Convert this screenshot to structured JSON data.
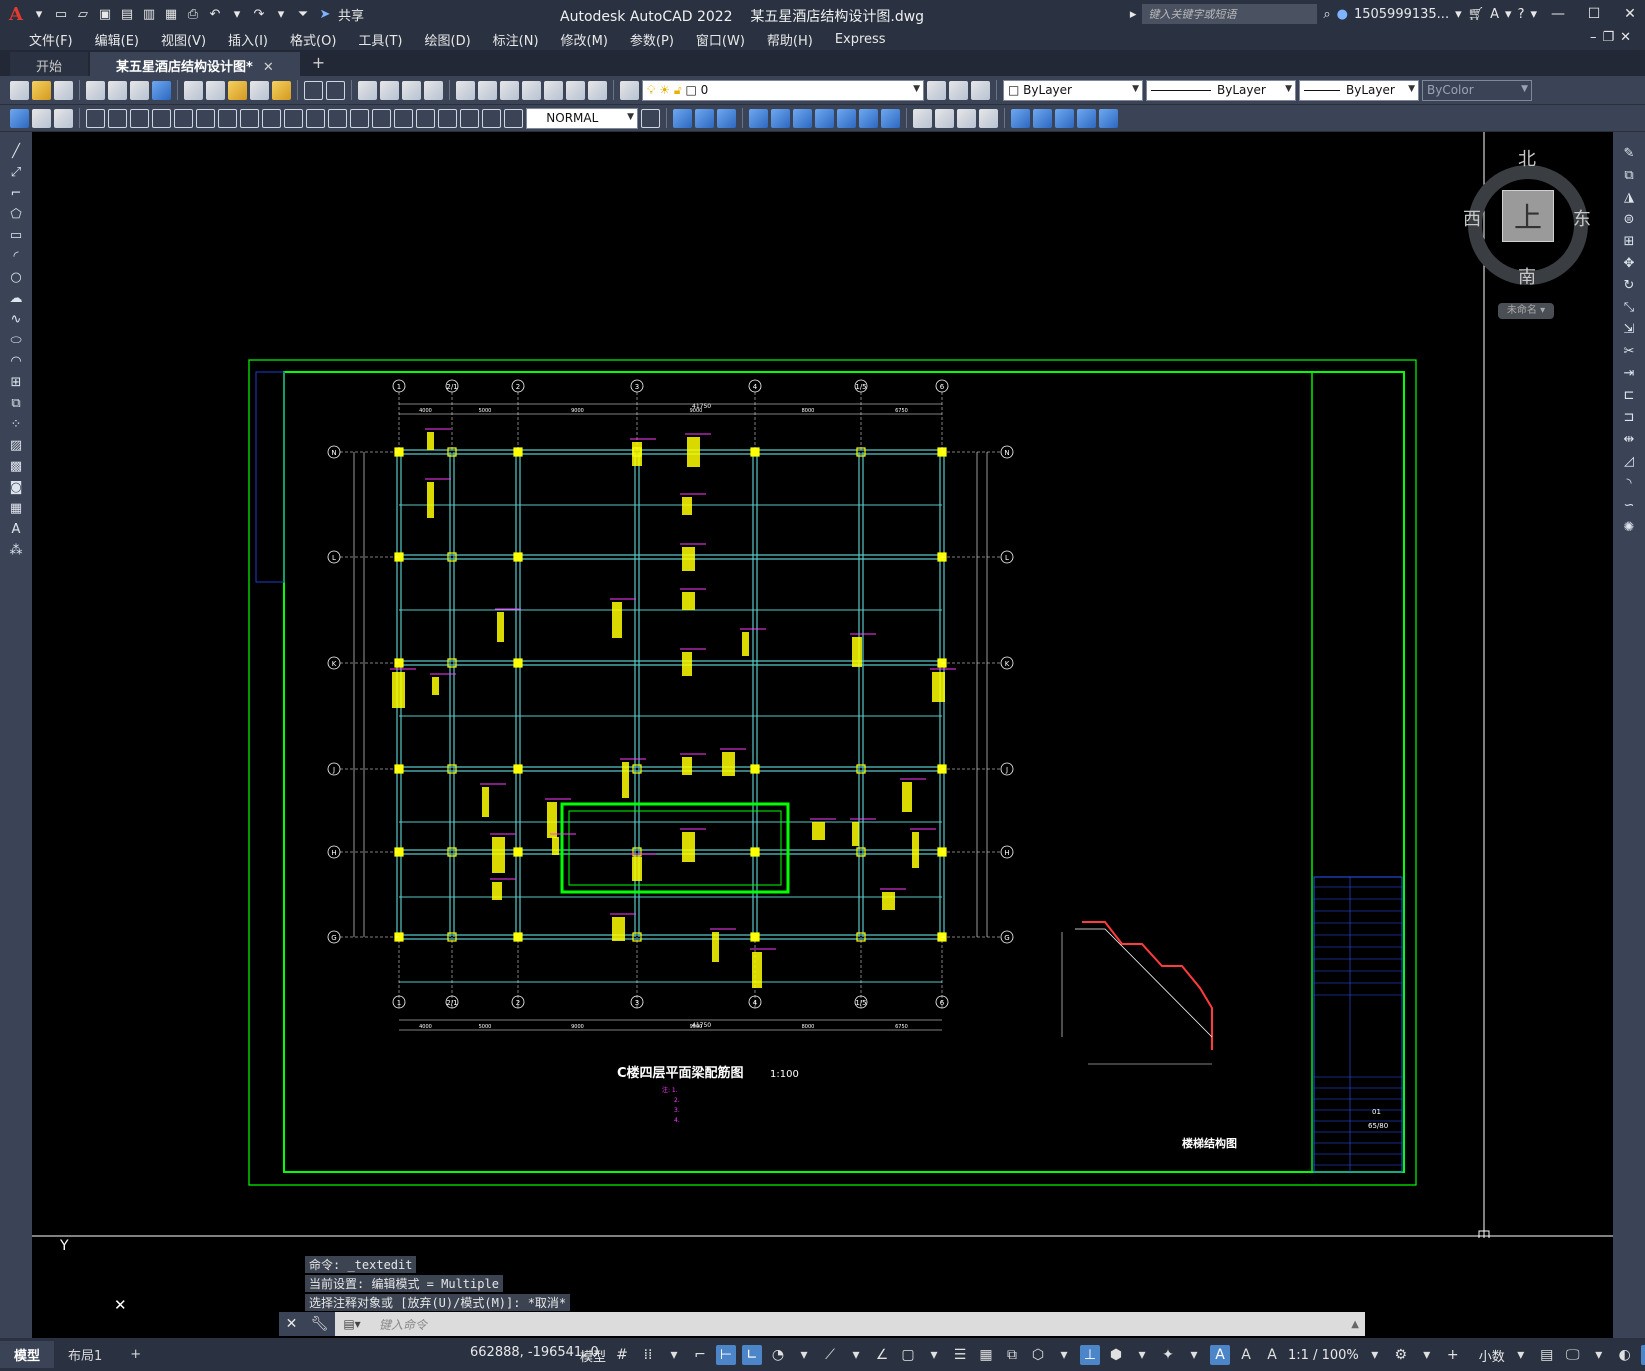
{
  "titlebar": {
    "app_name": "Autodesk AutoCAD 2022",
    "file_name": "某五星酒店结构设计图.dwg",
    "share_label": "共享",
    "search_placeholder": "键入关键字或短语",
    "user": "1505999135..."
  },
  "menu": [
    "文件(F)",
    "编辑(E)",
    "视图(V)",
    "插入(I)",
    "格式(O)",
    "工具(T)",
    "绘图(D)",
    "标注(N)",
    "修改(M)",
    "参数(P)",
    "窗口(W)",
    "帮助(H)",
    "Express"
  ],
  "tabs": {
    "start": "开始",
    "drawing": "某五星酒店结构设计图*"
  },
  "toolbar": {
    "layer_value": "0",
    "color_value": "ByLayer",
    "linetype_value": "ByLayer",
    "lineweight_value": "ByLayer",
    "plotstyle_value": "ByColor",
    "style_value": "NORMAL"
  },
  "viewcube": {
    "north": "北",
    "south": "南",
    "west": "西",
    "east": "东",
    "top": "上",
    "ucs": "未命名"
  },
  "drawing": {
    "plan_title": "C楼四层平面梁配筋图",
    "plan_scale": "1:100",
    "stair_title": "楼梯结构图",
    "top_axes": [
      "1",
      "2/1",
      "2",
      "3",
      "4",
      "1/5",
      "6"
    ],
    "side_axes": [
      "N",
      "L",
      "K",
      "J",
      "H",
      "G"
    ],
    "top_dims": [
      "4000",
      "5000",
      "9000",
      "9000",
      "8000",
      "6750"
    ],
    "total_dim": "41750",
    "notes": [
      "注: 1.",
      "2.",
      "3.",
      "4."
    ],
    "sheet_number": "01",
    "sheet_count": "65/80"
  },
  "command": {
    "history": [
      "命令: _textedit",
      "当前设置: 编辑模式 = Multiple",
      "选择注释对象或 [放弃(U)/模式(M)]: *取消*"
    ],
    "placeholder": "键入命令"
  },
  "status": {
    "model_tab": "模型",
    "layout_tab": "布局1",
    "coords": "662888, -196541, 0",
    "space": "模型",
    "scale": "1:1 / 100%",
    "units": "小数"
  },
  "colors": {
    "frame_green": "#00ff00",
    "beam_cyan": "#58c8c8",
    "column_yellow": "#ffff00",
    "tag_magenta": "#ff3cff",
    "app_red": "#e03b2e"
  }
}
